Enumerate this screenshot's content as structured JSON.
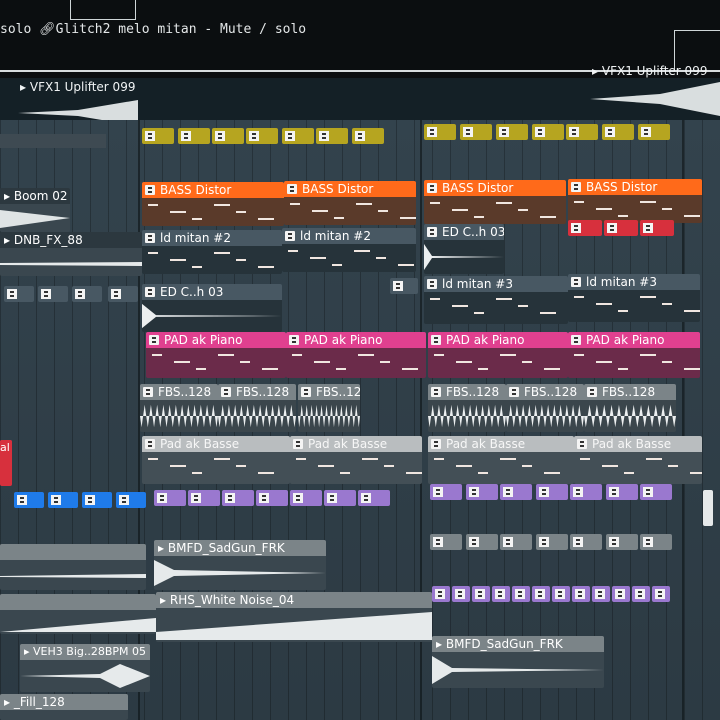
{
  "hint_bar": {
    "prefix": "solo ",
    "link_text": "Glitch2 melo mitan",
    "suffix": " - Mute / solo"
  },
  "uplifter_left": "VFX1 Uplifter 099",
  "uplifter_right": "VFX1 Uplifter 099",
  "tracks": {
    "boom": "Boom 02",
    "dnb": "DNB_FX_88",
    "bass": "BASS Distor",
    "ld2": "ld mitan #2",
    "ld3": "ld mitan #3",
    "edch": "ED C..h 03",
    "pad": "PAD ak Piano",
    "fbs": "FBS..128",
    "padbass": "Pad ak Basse",
    "bmfd": "BMFD_SadGun_FRK",
    "rhs": "RHS_White Noise_04",
    "veh": "VEH3 Big..28BPM 05",
    "fill": "_Fill_128",
    "al": "al"
  },
  "colors": {
    "orange": "#ff6a1a",
    "magenta": "#e0408f",
    "purple": "#9a78cf",
    "blue": "#1f7bea",
    "yellow": "#b6a520",
    "red": "#d7303d"
  }
}
